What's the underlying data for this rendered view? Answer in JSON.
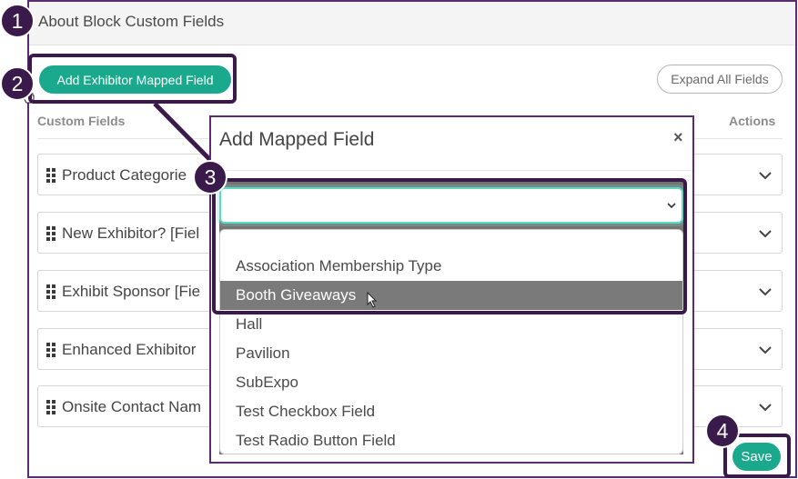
{
  "block": {
    "title": "About Block Custom Fields",
    "add_button_label": "Add Exhibitor Mapped Field",
    "expand_button_label": "Expand All Fields",
    "col_custom_fields": "Custom Fields",
    "col_actions": "Actions",
    "fields": [
      {
        "label": "Product Categorie"
      },
      {
        "label": "New Exhibitor? [Fiel"
      },
      {
        "label": "Exhibit Sponsor [Fie"
      },
      {
        "label": "Enhanced Exhibitor"
      },
      {
        "label": "Onsite Contact Nam"
      }
    ]
  },
  "modal": {
    "title": "Add Mapped Field",
    "close_symbol": "×",
    "select_value": "",
    "options": [
      "",
      "Association Membership Type",
      "Booth Giveaways",
      "Hall",
      "Pavilion",
      "SubExpo",
      "Test Checkbox Field",
      "Test Radio Button Field"
    ],
    "selected_option": "Booth Giveaways"
  },
  "save_label": "Save",
  "annotations": [
    "1",
    "2",
    "3",
    "4"
  ],
  "colors": {
    "accent": "#1aa98c",
    "annotation": "#3a1a4a",
    "frame": "#5b2c6f",
    "focus": "#63d9c4",
    "selected_option_bg": "#7a7a7a"
  }
}
